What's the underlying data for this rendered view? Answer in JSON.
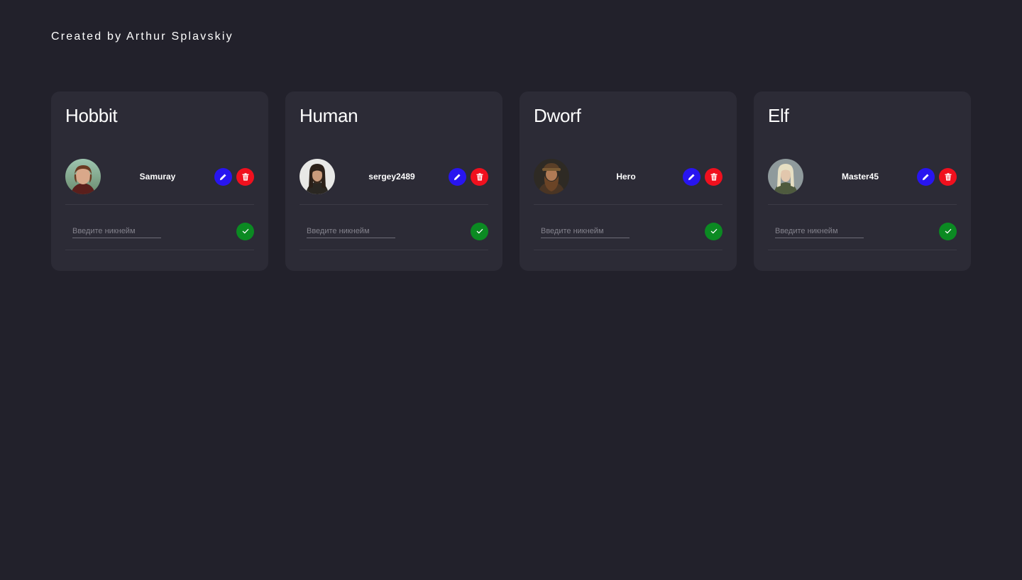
{
  "credit": "Created by Arthur Splavskiy",
  "colors": {
    "background": "#22212b",
    "card": "#2c2b36",
    "edit_button": "#2815f0",
    "delete_button": "#f0101e",
    "confirm_button": "#0b8a22"
  },
  "cards": [
    {
      "title": "Hobbit",
      "nickname": "Samuray",
      "input_placeholder": "Введите никнейм",
      "input_value": "",
      "edit_icon": "pencil-icon",
      "delete_icon": "trash-icon",
      "confirm_icon": "check-icon"
    },
    {
      "title": "Human",
      "nickname": "sergey2489",
      "input_placeholder": "Введите никнейм",
      "input_value": "",
      "edit_icon": "pencil-icon",
      "delete_icon": "trash-icon",
      "confirm_icon": "check-icon"
    },
    {
      "title": "Dworf",
      "nickname": "Hero",
      "input_placeholder": "Введите никнейм",
      "input_value": "",
      "edit_icon": "pencil-icon",
      "delete_icon": "trash-icon",
      "confirm_icon": "check-icon"
    },
    {
      "title": "Elf",
      "nickname": "Master45",
      "input_placeholder": "Введите никнейм",
      "input_value": "",
      "edit_icon": "pencil-icon",
      "delete_icon": "trash-icon",
      "confirm_icon": "check-icon"
    }
  ]
}
